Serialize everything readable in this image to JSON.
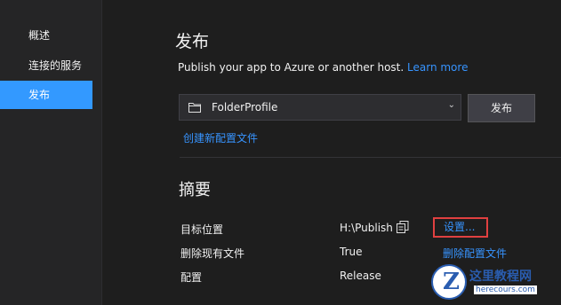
{
  "sidebar": {
    "items": [
      {
        "label": "概述",
        "active": false
      },
      {
        "label": "连接的服务",
        "active": false
      },
      {
        "label": "发布",
        "active": true
      }
    ]
  },
  "main": {
    "title": "发布",
    "subtitle": "Publish your app to Azure or another host.",
    "learn_more": "Learn more",
    "profile_select": {
      "value": "FolderProfile",
      "icon": "folder-icon"
    },
    "publish_button": "发布",
    "create_profile_link": "创建新配置文件",
    "summary": {
      "title": "摘要",
      "rows": [
        {
          "label": "目标位置",
          "value": "H:\\Publish"
        },
        {
          "label": "删除现有文件",
          "value": "True"
        },
        {
          "label": "配置",
          "value": "Release"
        }
      ],
      "settings_link": "设置...",
      "delete_profile_link": "删除配置文件"
    }
  },
  "watermark": {
    "title": "这里教程网",
    "url": "herecours.com"
  },
  "colors": {
    "accent": "#3399ff",
    "link": "#3794ff",
    "highlight_box": "#e04040",
    "background": "#1e1e1e"
  }
}
